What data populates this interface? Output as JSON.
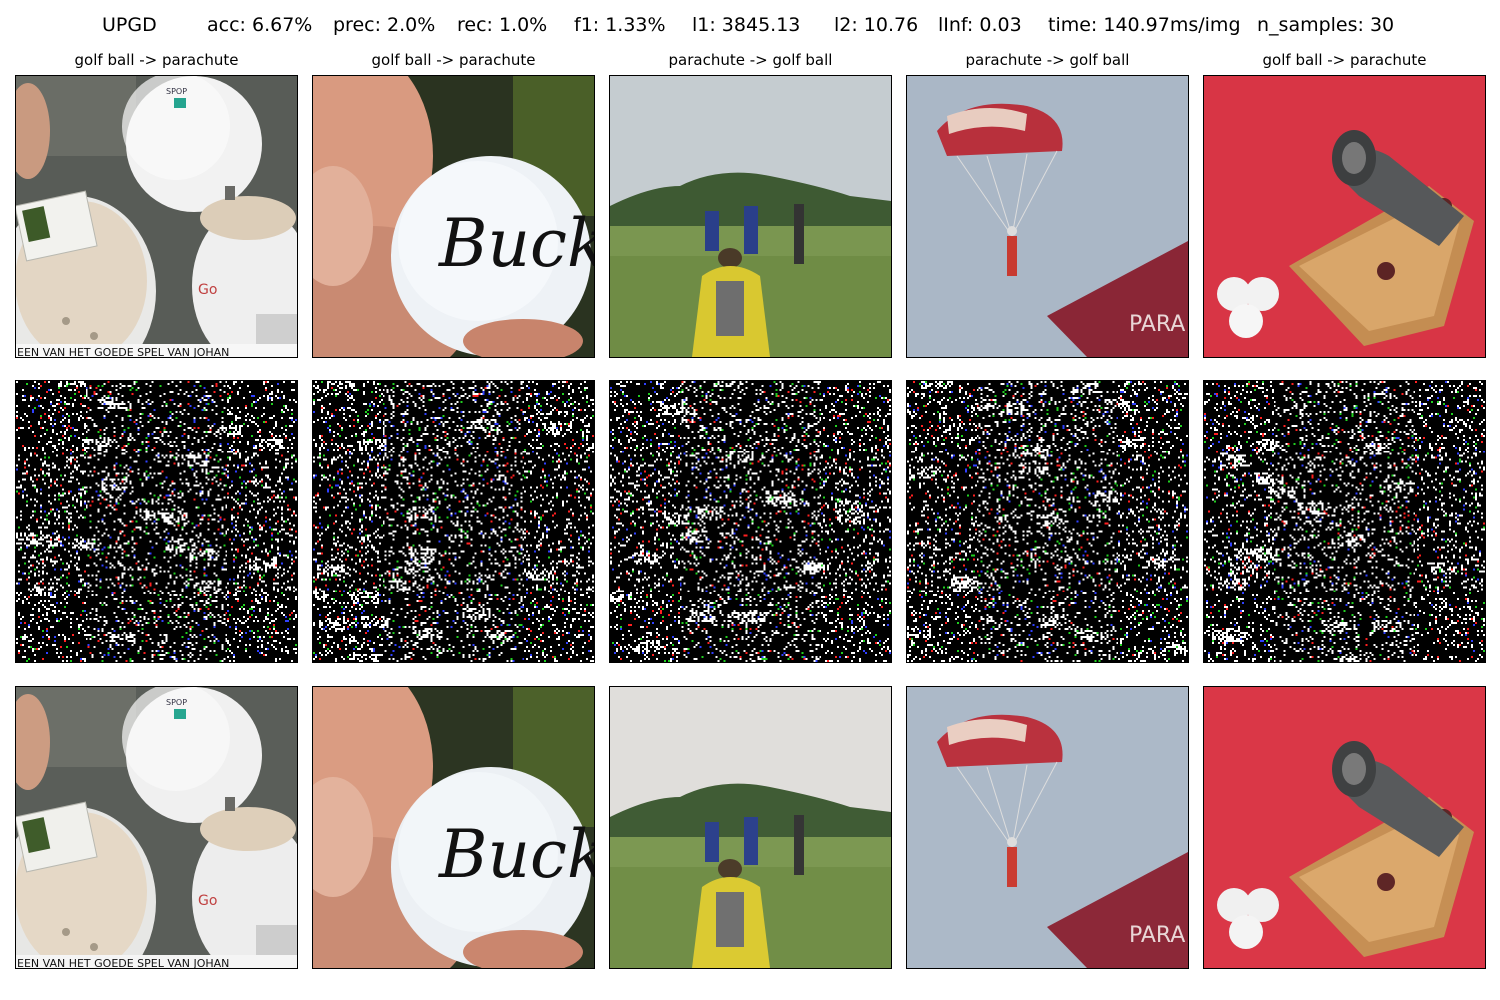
{
  "header": {
    "method": "UPGD",
    "acc": "acc: 6.67%",
    "prec": "prec: 2.0%",
    "rec": "rec: 1.0%",
    "f1": "f1: 1.33%",
    "l1": "l1: 3845.13",
    "l2": "l2: 10.76",
    "linf": "lInf: 0.03",
    "time": "time: 140.97ms/img",
    "n_samples": "n_samples: 30"
  },
  "columns": [
    {
      "title": "golf ball -> parachute",
      "scene": "golf-ball-usb"
    },
    {
      "title": "golf ball -> parachute",
      "scene": "golf-ball-signed"
    },
    {
      "title": "parachute -> golf ball",
      "scene": "parachute-field"
    },
    {
      "title": "parachute -> golf ball",
      "scene": "parachute-sky"
    },
    {
      "title": "golf ball -> parachute",
      "scene": "cannon-golf-balls"
    }
  ],
  "image_text": {
    "usb_banner": "EEN VAN HET GOEDE SPEL VAN JOHAN",
    "signature": "Bucks",
    "flag_text": "PARA REG"
  },
  "colors": {
    "noise_bg": "#000000",
    "grass": "#6f8c45",
    "sky": "#aab7c6",
    "red_felt": "#d83545"
  }
}
